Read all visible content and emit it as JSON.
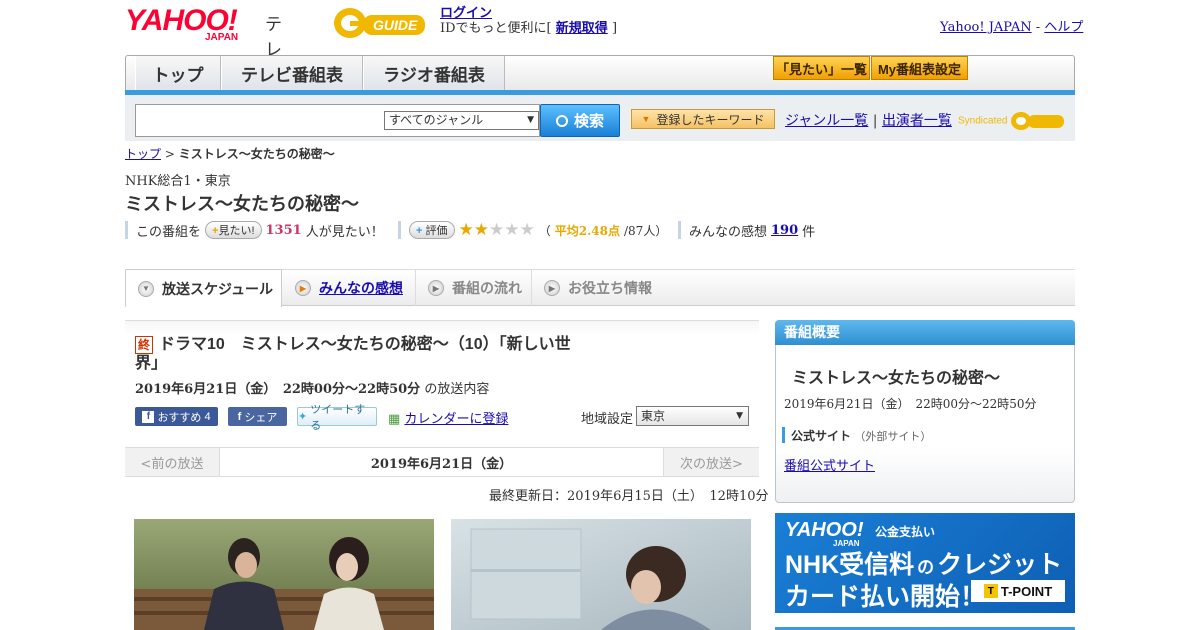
{
  "header": {
    "logo_yahoo": "YAHOO!",
    "logo_japan": "JAPAN",
    "logo_tv": "テレビ",
    "gguide_text": "GUIDE",
    "login_label": "ログイン",
    "login_prompt": "IDでもっと便利に[",
    "signup_label": "新規取得",
    "login_suffix": "]",
    "yahoo_japan_link": "Yahoo! JAPAN",
    "separator": "-",
    "help_link": "ヘルプ"
  },
  "nav": {
    "tabs": [
      "トップ",
      "テレビ番組表",
      "ラジオ番組表"
    ],
    "mitai_list": "「見たい」一覧",
    "my_schedule": "My番組表設定"
  },
  "search": {
    "input_value": "",
    "genre_selected": "すべてのジャンル",
    "search_button": "検索",
    "keyword_button": "登録したキーワード",
    "genre_list": "ジャンル一覧",
    "divider": "|",
    "performer_list": "出演者一覧",
    "syndicated": "Syndicated"
  },
  "breadcrumb": {
    "top": "トップ",
    "sep": ">",
    "current": "ミストレス～女たちの秘密～"
  },
  "program": {
    "channel": "NHK総合1・東京",
    "title": "ミストレス～女たちの秘密～",
    "mitai_prefix": "この番組を",
    "mitai_button": "見たい!",
    "mitai_count": "1351",
    "mitai_suffix": "人が見たい！",
    "rating_button": "評価",
    "rating_open": "（",
    "rating_avg": "平均2.48点",
    "rating_count": "/87人）",
    "rating_value": 2.48,
    "rating_max": 5,
    "impressions_prefix": "みんなの感想",
    "impressions_count": "190",
    "impressions_suffix": "件"
  },
  "tabs": {
    "schedule": "放送スケジュール",
    "impressions": "みんなの感想",
    "flow": "番組の流れ",
    "info": "お役立ち情報"
  },
  "episode": {
    "owari": "終",
    "title": "ドラマ10　ミストレス～女たちの秘密～（10）「新しい世界」",
    "date": "2019年6月21日（金）　22時00分～22時50分",
    "date_suffix": "の放送内容",
    "fb_recommend": "おすすめ",
    "fb_count": "4",
    "fb_share": "シェア",
    "tweet": "ツイートする",
    "calendar": "カレンダーに登録",
    "region_label": "地域設定",
    "region_selected": "東京"
  },
  "date_nav": {
    "prev": "<前の放送",
    "current": "2019年6月21日（金）",
    "next": "次の放送>"
  },
  "updated": "最終更新日：2019年6月15日（土）　12時10分",
  "sidebar": {
    "overview_heading": "番組概要",
    "title": "ミストレス～女たちの秘密～",
    "date": "2019年6月21日（金）　22時00分～22時50分",
    "official_label": "公式サイト",
    "official_note": "（外部サイト）",
    "official_link": "番組公式サイト",
    "banner_logo": "YAHOO!",
    "banner_logo_sub": "JAPAN",
    "banner_tag": "公金支払い",
    "banner_line1": "NHK受信料",
    "banner_no": "の",
    "banner_line1b": "クレジット",
    "banner_line2": "カード払い開始！",
    "banner_tpoint": "T-POINT"
  },
  "colors": {
    "accent_blue": "#3a9be0",
    "yahoo_red": "#ff0033",
    "gguide_yellow": "#f0b800",
    "mitai_pink": "#cc3366",
    "rating_orange": "#e8a800"
  }
}
